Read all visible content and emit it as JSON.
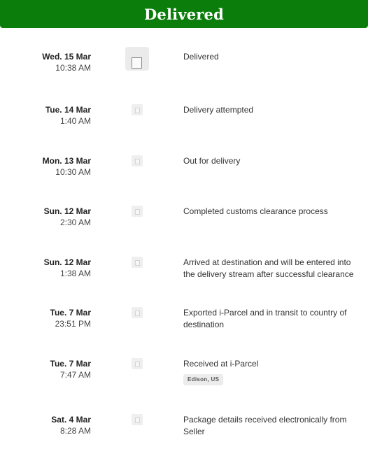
{
  "header": {
    "title": "Delivered",
    "background_color": "#0a7d0a"
  },
  "events": [
    {
      "day": "Wed. 15 Mar",
      "time": "10:38 AM",
      "description": "Delivered",
      "is_current": true,
      "marker_icon": "checkbox-icon"
    },
    {
      "day": "Tue. 14 Mar",
      "time": "1:40 AM",
      "description": "Delivery attempted",
      "is_current": false,
      "marker_icon": "checkbox-icon"
    },
    {
      "day": "Mon. 13 Mar",
      "time": "10:30 AM",
      "description": "Out for delivery",
      "is_current": false,
      "marker_icon": "checkbox-icon"
    },
    {
      "day": "Sun. 12 Mar",
      "time": "2:30 AM",
      "description": "Completed customs clearance process",
      "is_current": false,
      "marker_icon": "checkbox-icon"
    },
    {
      "day": "Sun. 12 Mar",
      "time": "1:38 AM",
      "description": "Arrived at destination and will be entered into the delivery stream after successful clearance",
      "is_current": false,
      "marker_icon": "checkbox-icon"
    },
    {
      "day": "Tue. 7 Mar",
      "time": "23:51 PM",
      "description": "Exported i-Parcel and in transit to country of destination",
      "is_current": false,
      "marker_icon": "checkbox-icon"
    },
    {
      "day": "Tue. 7 Mar",
      "time": "7:47 AM",
      "description": "Received at i-Parcel",
      "location": "Edison, US",
      "is_current": false,
      "marker_icon": "checkbox-icon"
    },
    {
      "day": "Sat. 4 Mar",
      "time": "8:28 AM",
      "description": "Package details received electronically from Seller",
      "is_current": false,
      "marker_icon": "checkbox-icon"
    }
  ]
}
